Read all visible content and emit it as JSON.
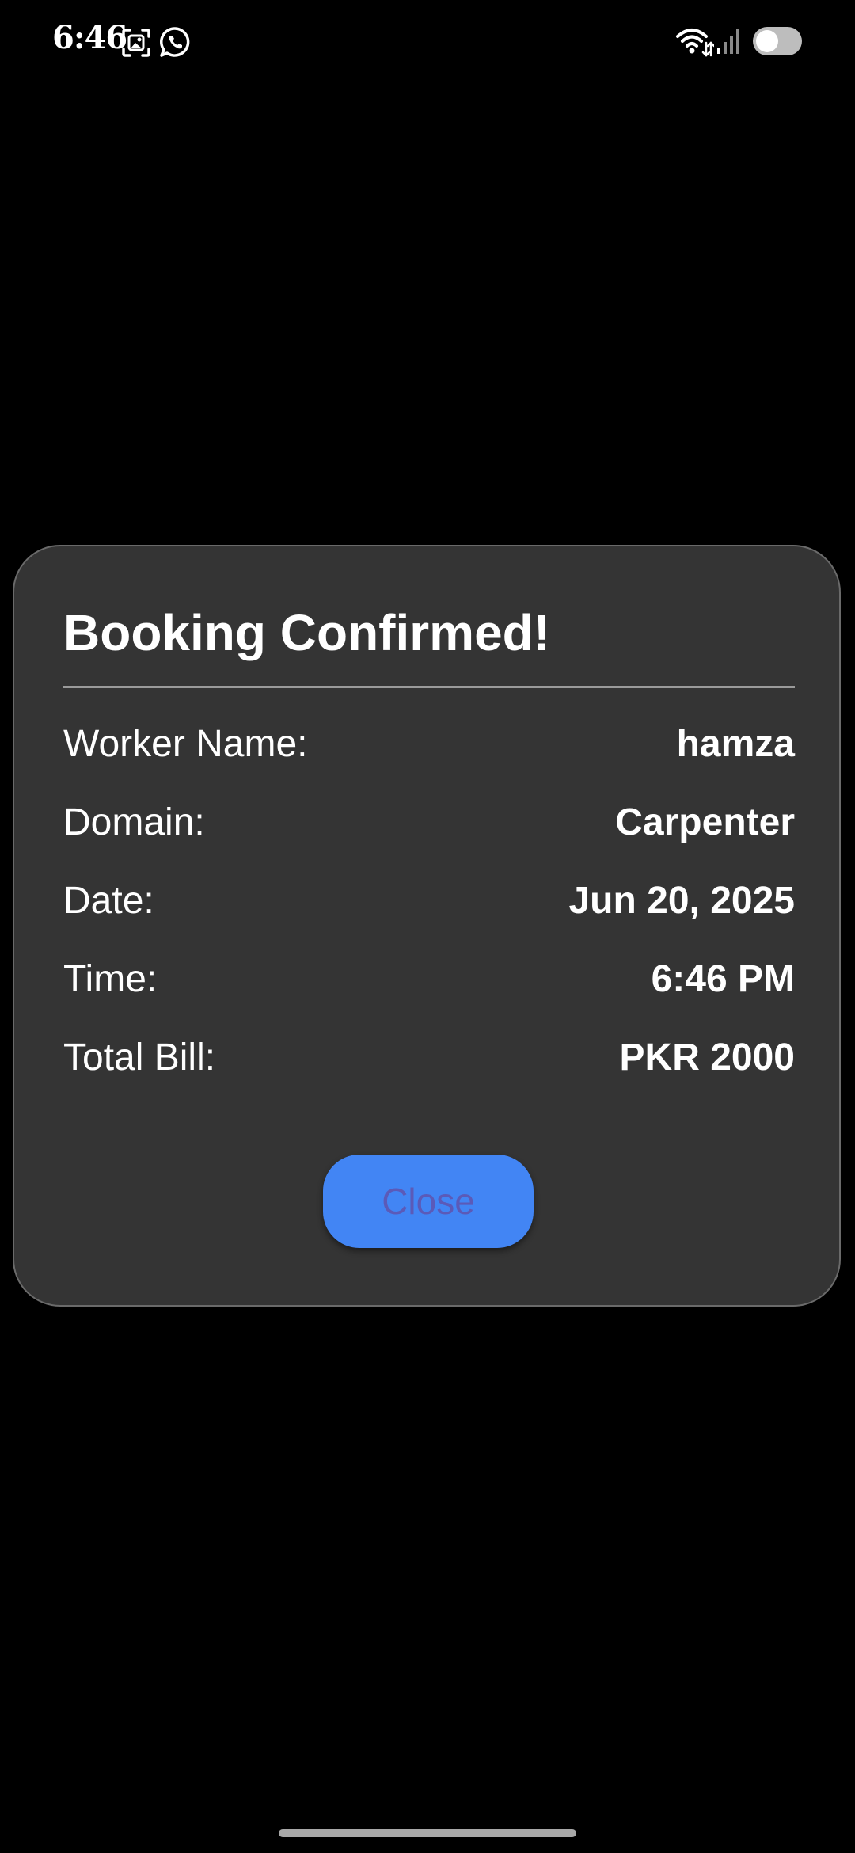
{
  "status_bar": {
    "time": "6:46",
    "icons": [
      "screenshot-icon",
      "whatsapp-icon",
      "wifi-icon",
      "signal-icon",
      "toggle-icon"
    ]
  },
  "dialog": {
    "title": "Booking Confirmed!",
    "rows": [
      {
        "label": "Worker Name:",
        "value": "hamza"
      },
      {
        "label": "Domain:",
        "value": "Carpenter"
      },
      {
        "label": "Date:",
        "value": "Jun 20, 2025"
      },
      {
        "label": "Time:",
        "value": "6:46 PM"
      },
      {
        "label": "Total Bill:",
        "value": "PKR 2000"
      }
    ],
    "close_label": "Close"
  },
  "colors": {
    "background": "#000000",
    "dialog_background": "#343434",
    "button_background": "#4285f4",
    "button_text": "#5b5ab8"
  }
}
